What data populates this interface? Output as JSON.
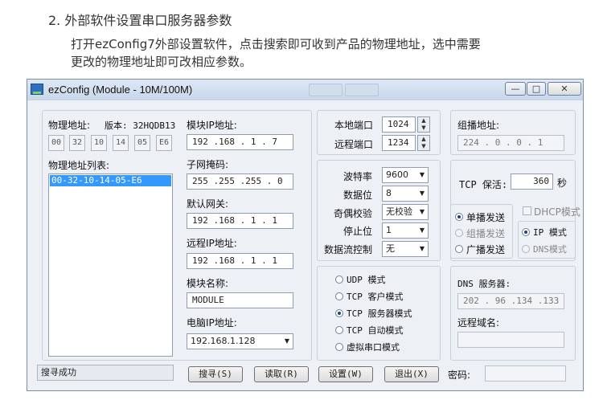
{
  "doc": {
    "heading": "2. 外部软件设置串口服务器参数",
    "para_line1": "打开ezConfig7外部设置软件，点击搜索即可收到产品的物理地址，选中需要",
    "para_line2": "更改的物理地址即可改相应参数。"
  },
  "window": {
    "title": "ezConfig (Module - 10M/100M)",
    "minimize": "—",
    "maximize": "□",
    "close": "✕"
  },
  "left": {
    "mac_label": "物理地址:",
    "version_label": "版本: 32HQDB13",
    "mac_parts": [
      "00",
      "32",
      "10",
      "14",
      "05",
      "E6"
    ],
    "list_label": "物理地址列表:",
    "list_items": [
      "00-32-10-14-05-E6"
    ]
  },
  "module": {
    "ip_label": "模块IP地址:",
    "ip": "192 .168 . 1 . 7",
    "mask_label": "子网掩码:",
    "mask": "255 .255 .255 . 0",
    "gateway_label": "默认网关:",
    "gateway": "192 .168 . 1 . 1",
    "remote_ip_label": "远程IP地址:",
    "remote_ip": "192 .168 . 1 . 1",
    "name_label": "模块名称:",
    "name": "MODULE",
    "pc_ip_label": "电脑IP地址:",
    "pc_ip": "192.168.1.128"
  },
  "ports": {
    "local_label": "本地端口",
    "local": "1024",
    "remote_label": "远程端口",
    "remote": "1234"
  },
  "serial": {
    "baud_label": "波特率",
    "baud": "9600",
    "databits_label": "数据位",
    "databits": "8",
    "parity_label": "奇偶校验",
    "parity": "无校验",
    "stopbits_label": "停止位",
    "stopbits": "1",
    "flow_label": "数据流控制",
    "flow": "无"
  },
  "modes": {
    "options": [
      "UDP 模式",
      "TCP 客户模式",
      "TCP 服务器模式",
      "TCP 自动模式",
      "虚拟串口模式"
    ],
    "selected": "TCP 服务器模式"
  },
  "right": {
    "multicast_label": "组播地址:",
    "multicast": "224 . 0 . 0 . 1",
    "keepalive_label": "TCP 保活:",
    "keepalive": "360",
    "keepalive_unit": "秒",
    "send_modes": [
      "单播发送",
      "组播发送",
      "广播发送"
    ],
    "send_selected": "单播发送",
    "dhcp_label": "DHCP模式",
    "ip_mode_label": "IP 模式",
    "dns_mode_label": "DNS模式",
    "dns_label": "DNS 服务器:",
    "dns": "202 . 96 .134 .133",
    "domain_label": "远程域名:",
    "domain": ""
  },
  "bottom": {
    "status": "搜寻成功",
    "search": "搜寻(S)",
    "read": "读取(R)",
    "set": "设置(W)",
    "exit": "退出(X)",
    "password_label": "密码:",
    "password": ""
  }
}
